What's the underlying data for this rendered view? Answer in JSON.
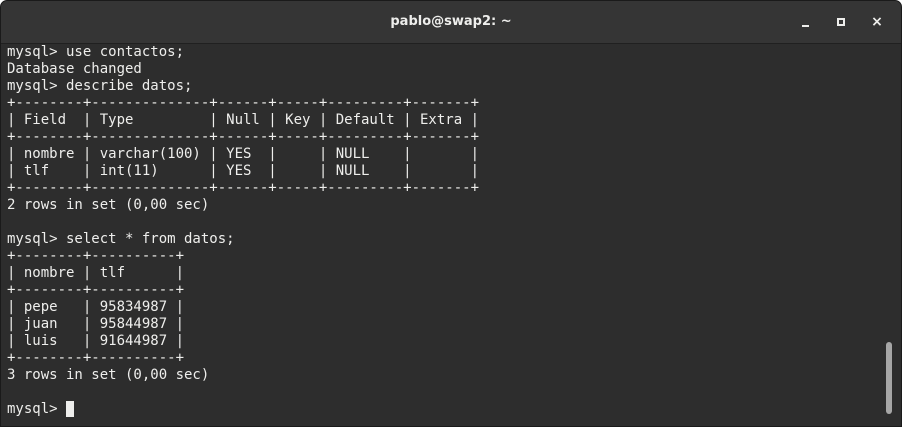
{
  "window": {
    "title": "pablo@swap2: ~",
    "minimize_icon": "minimize-icon",
    "maximize_icon": "maximize-icon",
    "close_icon": "close-icon",
    "close_glyph": "×"
  },
  "terminal": {
    "lines": [
      "mysql> use contactos;",
      "Database changed",
      "mysql> describe datos;",
      "+--------+--------------+------+-----+---------+-------+",
      "| Field  | Type         | Null | Key | Default | Extra |",
      "+--------+--------------+------+-----+---------+-------+",
      "| nombre | varchar(100) | YES  |     | NULL    |       |",
      "| tlf    | int(11)      | YES  |     | NULL    |       |",
      "+--------+--------------+------+-----+---------+-------+",
      "2 rows in set (0,00 sec)",
      "",
      "mysql> select * from datos;",
      "+--------+----------+",
      "| nombre | tlf      |",
      "+--------+----------+",
      "| pepe   | 95834987 |",
      "| juan   | 95844987 |",
      "| luis   | 91644987 |",
      "+--------+----------+",
      "3 rows in set (0,00 sec)",
      "",
      "mysql> "
    ],
    "colors": {
      "background": "#2d2d2d",
      "foreground": "#eeeeec",
      "titlebar": "#353535"
    }
  }
}
